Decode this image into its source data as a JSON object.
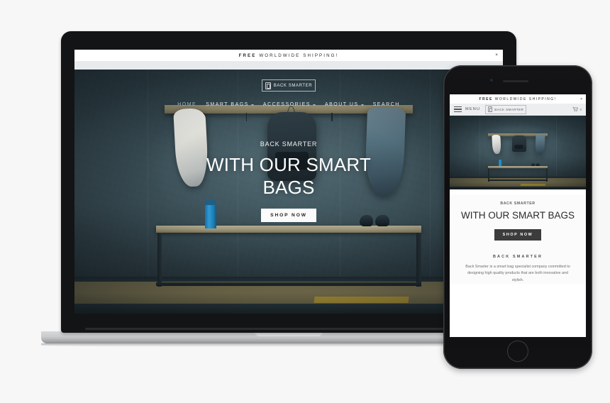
{
  "site": {
    "brand": "BACK SMARTER",
    "announcement_bold": "FREE",
    "announcement_rest": "WORLDWIDE SHIPPING!",
    "close_icon": "×"
  },
  "desktop": {
    "nav": [
      {
        "label": "HOME",
        "has_caret": false,
        "active": true
      },
      {
        "label": "SMART BAGS",
        "has_caret": true,
        "active": false
      },
      {
        "label": "ACCESSORIES",
        "has_caret": true,
        "active": false
      },
      {
        "label": "ABOUT US",
        "has_caret": true,
        "active": false
      },
      {
        "label": "SEARCH",
        "has_caret": false,
        "active": false
      }
    ],
    "hero": {
      "eyebrow": "BACK SMARTER",
      "headline": "WITH OUR SMART BAGS",
      "cta": "SHOP NOW"
    }
  },
  "mobile": {
    "menu_label": "MENU",
    "cart_count": "0",
    "hero": {
      "eyebrow": "BACK SMARTER",
      "headline": "WITH OUR SMART BAGS",
      "cta": "SHOP NOW"
    },
    "about": {
      "title": "BACK SMARTER",
      "paragraph": "Back Smarter is a smart bag specialist company  committed to designing high quality products that are both innovative and stylish."
    }
  },
  "colors": {
    "page_bg": "#f7f7f7",
    "hero_wall": "#35474e",
    "accent_bottle": "#2f9ad3",
    "floor_stripe": "#c9a838",
    "dark_button": "#3c3c3c"
  }
}
